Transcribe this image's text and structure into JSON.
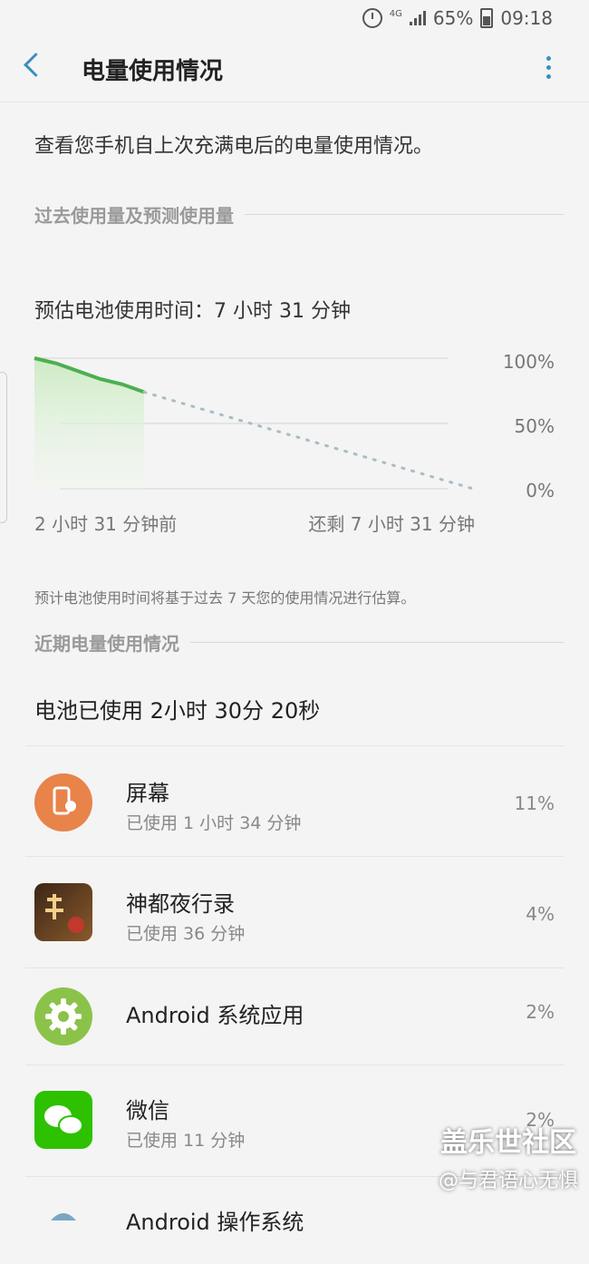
{
  "status_bar": {
    "network": "4G",
    "battery": "65%",
    "time": "09:18"
  },
  "header": {
    "title": "电量使用情况"
  },
  "intro": "查看您手机自上次充满电后的电量使用情况。",
  "sections": {
    "past": "过去使用量及预测使用量",
    "recent": "近期电量使用情况"
  },
  "estimate": "预估电池使用时间：7 小时 31 分钟",
  "chart_data": {
    "type": "line",
    "ytick_labels": [
      "100%",
      "50%",
      "0%"
    ],
    "xtick_labels": [
      "2 小时 31 分钟前",
      "还剩 7 小时 31 分钟"
    ],
    "ylim": [
      0,
      100
    ],
    "series": [
      {
        "style": "solid",
        "x": [
          0,
          0.2,
          0.4,
          0.6,
          0.8,
          1.0
        ],
        "y": [
          100,
          96,
          90,
          84,
          80,
          74
        ]
      },
      {
        "style": "dotted",
        "x": [
          1.0,
          4.0
        ],
        "y": [
          74,
          0
        ]
      }
    ],
    "colors": {
      "actual": "#4caf50",
      "predicted": "#a9bcc6",
      "fill": "#d8f0d0"
    }
  },
  "note": "预计电池使用时间将基于过去 7 天您的使用情况进行估算。",
  "used_total": "电池已使用 2小时 30分 20秒",
  "apps": [
    {
      "name": "屏幕",
      "sub": "已使用 1 小时 34 分钟",
      "pct": "11%",
      "icon": "screen-brightness-icon",
      "color": "#e8834a"
    },
    {
      "name": "神都夜行录",
      "sub": "已使用 36 分钟",
      "pct": "4%",
      "icon": "game-icon",
      "color": "#6b4a2a"
    },
    {
      "name": "Android 系统应用",
      "sub": "",
      "pct": "2%",
      "icon": "gear-icon",
      "color": "#8bc34a"
    },
    {
      "name": "微信",
      "sub": "已使用 11 分钟",
      "pct": "2%",
      "icon": "wechat-icon",
      "color": "#2dc100"
    },
    {
      "name": "Android 操作系统",
      "sub": "",
      "pct": "",
      "icon": "android-icon",
      "color": "#8bc34a"
    }
  ],
  "watermark": {
    "title": "盖乐世社区",
    "handle": "@与君语心无惧"
  }
}
